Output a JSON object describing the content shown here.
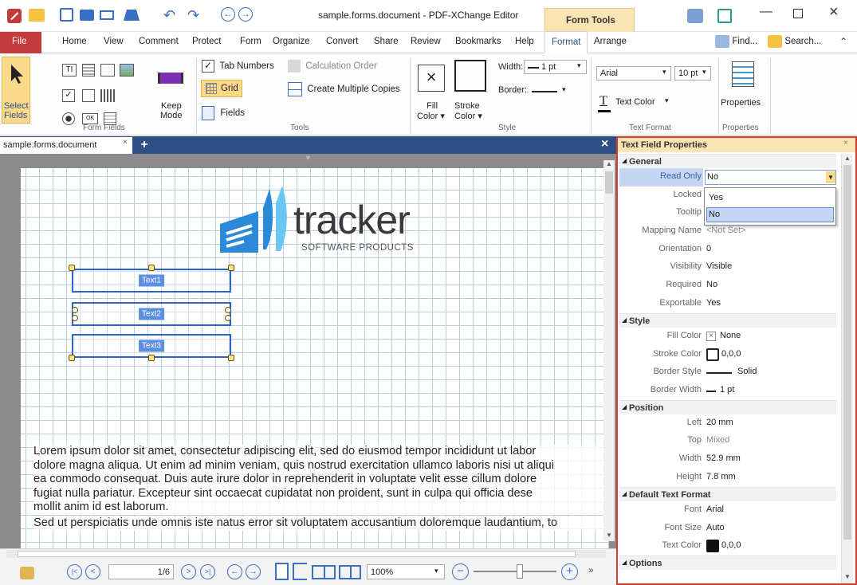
{
  "window": {
    "title": "sample.forms.document - PDF-XChange Editor",
    "context_tab": "Form Tools"
  },
  "menu": {
    "items": [
      "File",
      "Home",
      "View",
      "Comment",
      "Protect",
      "Form",
      "Organize",
      "Convert",
      "Share",
      "Review",
      "Bookmarks",
      "Help",
      "Format",
      "Arrange"
    ],
    "active": "Format",
    "find": "Find...",
    "search": "Search..."
  },
  "ribbon": {
    "select_fields": [
      "Select",
      "Fields"
    ],
    "keep_mode": [
      "Keep",
      "Mode"
    ],
    "group_form_fields": "Form Fields",
    "tab_numbers": "Tab Numbers",
    "calculation_order": "Calculation Order",
    "grid": "Grid",
    "create_multiple_copies": "Create Multiple Copies",
    "fields": "Fields",
    "group_tools": "Tools",
    "fill_color": [
      "Fill",
      "Color ▾"
    ],
    "stroke_color": [
      "Stroke",
      "Color ▾"
    ],
    "width_label": "Width:",
    "width_value": "1 pt",
    "border_label": "Border:",
    "group_style": "Style",
    "font_name": "Arial",
    "font_size": "10 pt",
    "text_color": "Text Color",
    "group_text_format": "Text Format",
    "properties": "Properties",
    "group_properties": "Properties"
  },
  "document": {
    "tab_label": "sample.forms.document",
    "logo_name": "tracker",
    "logo_sub": "SOFTWARE PRODUCTS",
    "fields": [
      "Text1",
      "Text2",
      "Text3"
    ],
    "paragraph1": [
      "Lorem ipsum dolor sit amet, consectetur adipiscing elit, sed do eiusmod tempor incididunt ut labor",
      "dolore magna aliqua. Ut enim ad minim veniam, quis nostrud exercitation ullamco laboris nisi ut aliqui",
      "ea commodo consequat. Duis aute irure dolor in reprehenderit in voluptate velit esse cillum dolore",
      "fugiat nulla pariatur. Excepteur sint occaecat cupidatat non proident, sunt in culpa qui officia dese",
      "mollit anim id est laborum."
    ],
    "paragraph2": "Sed ut perspiciatis unde omnis iste natus error sit voluptatem accusantium doloremque laudantium, to"
  },
  "statusbar": {
    "page": "1/6",
    "zoom": "100%"
  },
  "panel": {
    "title": "Text Field Properties",
    "sections": {
      "general": "General",
      "style": "Style",
      "position": "Position",
      "default_text_format": "Default Text Format",
      "options": "Options"
    },
    "general": [
      {
        "label": "Read Only",
        "value": "No"
      },
      {
        "label": "Locked",
        "value": ""
      },
      {
        "label": "Tooltip",
        "value": ""
      },
      {
        "label": "Mapping Name",
        "value": "<Not Set>"
      },
      {
        "label": "Orientation",
        "value": "0"
      },
      {
        "label": "Visibility",
        "value": "Visible"
      },
      {
        "label": "Required",
        "value": "No"
      },
      {
        "label": "Exportable",
        "value": "Yes"
      }
    ],
    "dropdown_options": [
      "Yes",
      "No"
    ],
    "style": [
      {
        "label": "Fill Color",
        "value": "None"
      },
      {
        "label": "Stroke Color",
        "value": "0,0,0"
      },
      {
        "label": "Border Style",
        "value": "Solid"
      },
      {
        "label": "Border Width",
        "value": "1 pt"
      }
    ],
    "position": [
      {
        "label": "Left",
        "value": "20 mm"
      },
      {
        "label": "Top",
        "value": "Mixed"
      },
      {
        "label": "Width",
        "value": "52.9 mm"
      },
      {
        "label": "Height",
        "value": "7.8 mm"
      }
    ],
    "text_format": [
      {
        "label": "Font",
        "value": "Arial"
      },
      {
        "label": "Font Size",
        "value": "Auto"
      },
      {
        "label": "Text Color",
        "value": "0,0,0"
      }
    ]
  },
  "colors": {
    "accent": "#2d4f86",
    "file_tab": "#c43b3b",
    "panel_border": "#d63b2f",
    "grid": "#b9cdea",
    "field_border": "#2c65c8",
    "selection": "#2c65c8"
  }
}
